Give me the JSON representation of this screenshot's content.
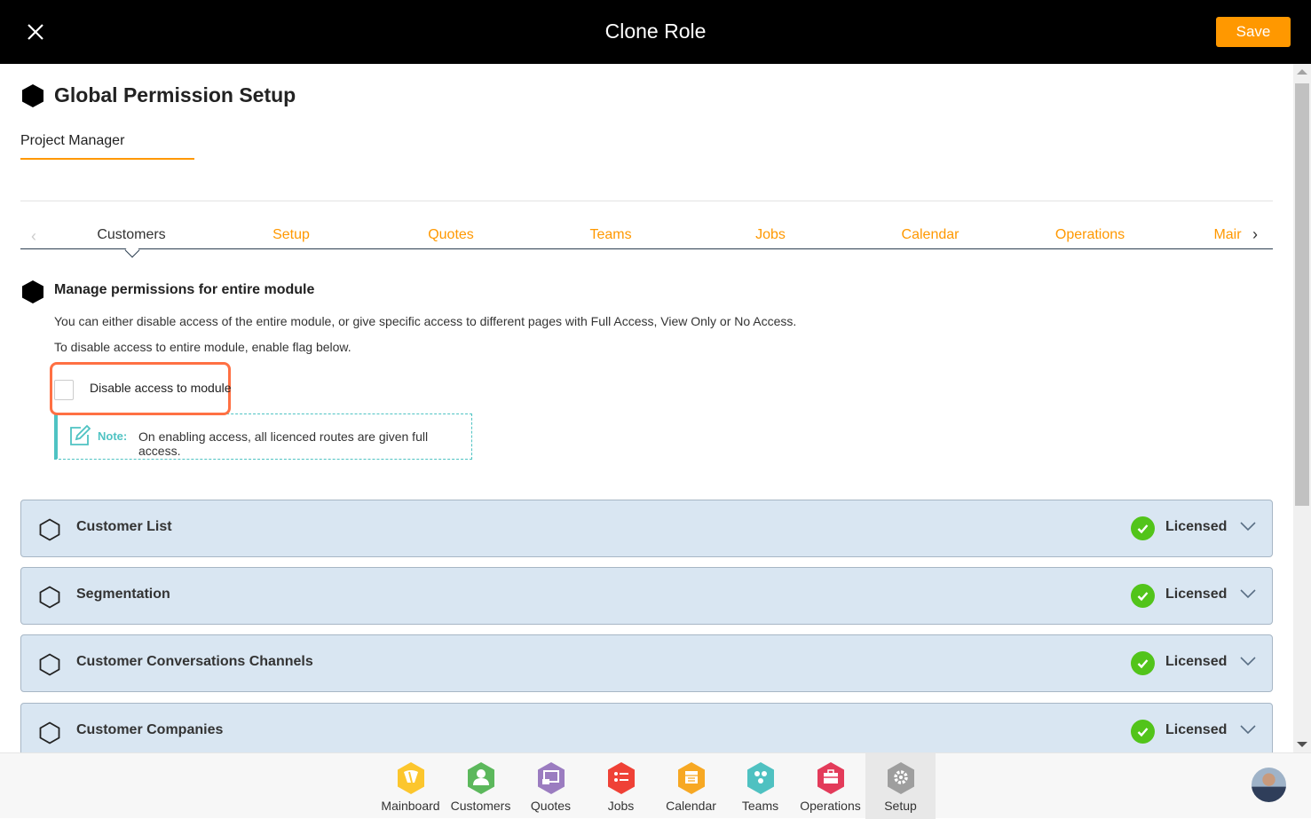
{
  "header": {
    "title": "Clone Role",
    "save_label": "Save"
  },
  "page": {
    "title": "Global Permission Setup",
    "role_name": "Project Manager"
  },
  "tabs": [
    {
      "label": "Customers",
      "active": true
    },
    {
      "label": "Setup"
    },
    {
      "label": "Quotes"
    },
    {
      "label": "Teams"
    },
    {
      "label": "Jobs"
    },
    {
      "label": "Calendar"
    },
    {
      "label": "Operations"
    },
    {
      "label": "Mair"
    }
  ],
  "module": {
    "heading": "Manage permissions for entire module",
    "description": "You can either disable access of the entire module, or give specific access to different pages with Full Access, View Only or No Access.",
    "instruction": "To disable access to entire module, enable flag below.",
    "checkbox_label": "Disable access to module",
    "checkbox_checked": false,
    "note_label": "Note:",
    "note_text": "On enabling access, all licenced routes are given full access."
  },
  "sections": [
    {
      "name": "Customer List",
      "status": "Licensed"
    },
    {
      "name": "Segmentation",
      "status": "Licensed"
    },
    {
      "name": "Customer Conversations Channels",
      "status": "Licensed"
    },
    {
      "name": "Customer Companies",
      "status": "Licensed"
    }
  ],
  "dock": [
    {
      "label": "Mainboard",
      "color": "#fcc62d",
      "icon": "mainboard-icon"
    },
    {
      "label": "Customers",
      "color": "#5cb85c",
      "icon": "customer-icon"
    },
    {
      "label": "Quotes",
      "color": "#9b7cc0",
      "icon": "quotes-icon"
    },
    {
      "label": "Jobs",
      "color": "#ef4136",
      "icon": "jobs-icon"
    },
    {
      "label": "Calendar",
      "color": "#f7a823",
      "icon": "calendar-icon"
    },
    {
      "label": "Teams",
      "color": "#4fc1c1",
      "icon": "teams-icon"
    },
    {
      "label": "Operations",
      "color": "#e33b5a",
      "icon": "operations-icon"
    },
    {
      "label": "Setup",
      "color": "#9e9e9e",
      "icon": "gear-icon",
      "active": true
    }
  ],
  "colors": {
    "accent": "#ff9800",
    "licensed": "#52c41a",
    "note": "#4fc3c3",
    "highlight": "#ff7043"
  }
}
